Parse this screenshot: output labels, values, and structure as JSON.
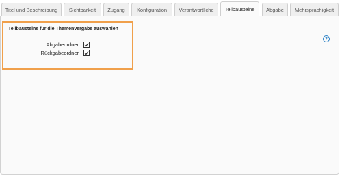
{
  "tabs": [
    {
      "label": "Titel und Beschreibung",
      "active": false
    },
    {
      "label": "Sichtbarkeit",
      "active": false
    },
    {
      "label": "Zugang",
      "active": false
    },
    {
      "label": "Konfiguration",
      "active": false
    },
    {
      "label": "Verantwortliche",
      "active": false
    },
    {
      "label": "Teilbausteine",
      "active": true
    },
    {
      "label": "Abgabe",
      "active": false
    },
    {
      "label": "Mehrsprachigkeit",
      "active": false
    }
  ],
  "section": {
    "title": "Teilbausteine für die Themenvergabe auswählen",
    "rows": [
      {
        "label": "Abgabeordner",
        "checked": true
      },
      {
        "label": "Rückgabeordner",
        "checked": true
      }
    ]
  },
  "help": {
    "icon": "help-icon",
    "glyph": "?"
  },
  "colors": {
    "highlight": "#f0a04b",
    "help": "#2a80c6"
  }
}
